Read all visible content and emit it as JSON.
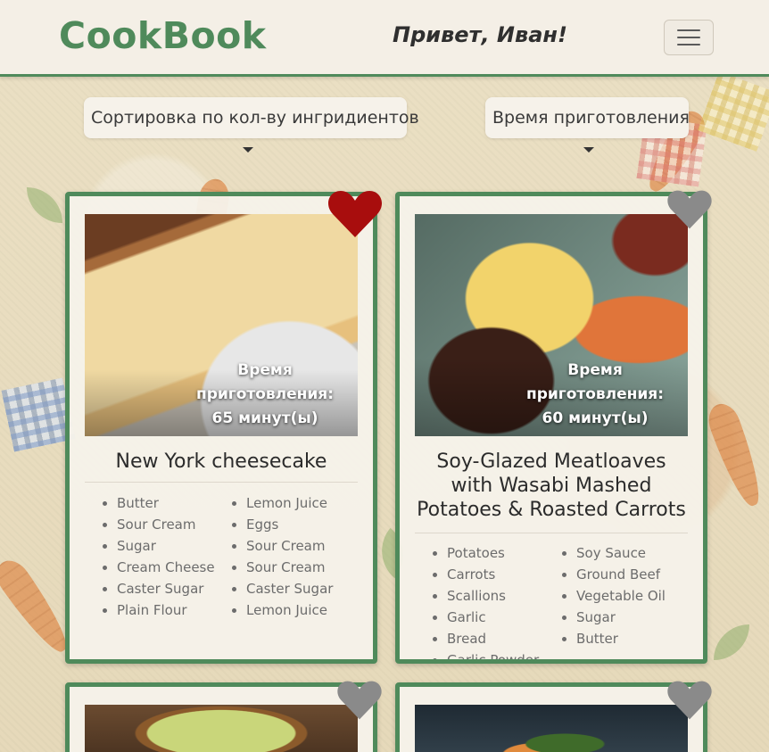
{
  "navbar": {
    "brand": "CookBook",
    "greeting": "Привет, Иван!"
  },
  "filters": {
    "sort_by_ingredients": "Сортировка по кол-ву ингридиентов",
    "cook_time": "Время приготовления"
  },
  "colors": {
    "accent": "#4f8a5b",
    "favorite_active": "#a80d0d",
    "favorite_inactive": "#8a8a8a"
  },
  "recipes": [
    {
      "title": "New York cheesecake",
      "time_label": "Время приготовления:",
      "time_value": "65 минут(ы)",
      "favorite": true,
      "ingredients_left": [
        "Butter",
        "Sour Cream",
        "Sugar",
        "Cream Cheese",
        "Caster Sugar",
        "Plain Flour"
      ],
      "ingredients_right": [
        "Lemon Juice",
        "Eggs",
        "Sour Cream",
        "Sour Cream",
        "Caster Sugar",
        "Lemon Juice"
      ]
    },
    {
      "title": "Soy-Glazed Meatloaves with Wasabi Mashed Potatoes & Roasted Carrots",
      "time_label": "Время приготовления:",
      "time_value": "60 минут(ы)",
      "favorite": false,
      "ingredients_left": [
        "Potatoes",
        "Carrots",
        "Scallions",
        "Garlic",
        "Bread",
        "Garlic Powder"
      ],
      "ingredients_right": [
        "Soy Sauce",
        "Ground Beef",
        "Vegetable Oil",
        "Sugar",
        "Butter"
      ]
    },
    {
      "favorite": false
    },
    {
      "favorite": false
    }
  ]
}
